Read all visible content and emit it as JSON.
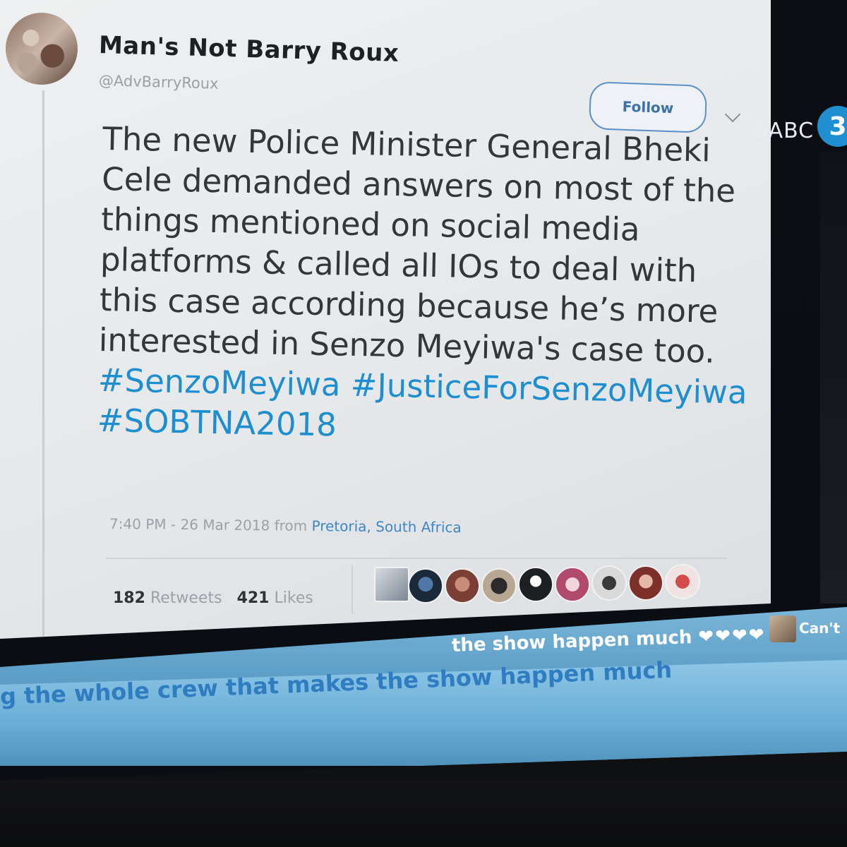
{
  "tweet": {
    "author_name": "Man's Not Barry Roux",
    "author_handle": "@AdvBarryRoux",
    "follow_label": "Follow",
    "text_lines": [
      "The new Police Minister General Bheki",
      "Cele demanded answers on most of the",
      "things mentioned on social media",
      "platforms & called all IOs to deal with",
      "this case according because he’s more",
      "interested in Senzo Meyiwa's case too."
    ],
    "hashtags_line_1": [
      "#SenzoMeyiwa",
      "#JusticeForSenzoMeyiwa"
    ],
    "hashtags_line_2": "#SOBTNA2018",
    "time": "7:40 PM - 26 Mar 2018",
    "from_label": "from",
    "location": "Pretoria, South Africa",
    "retweets_count": "182",
    "retweets_label": "Retweets",
    "likes_count": "421",
    "likes_label": "Likes"
  },
  "channel": {
    "logo_text": "SABC",
    "logo_number": "3"
  },
  "ticker": {
    "upper_text": "the show happen much",
    "upper_hearts": "❤❤❤❤",
    "next_text": "Can't",
    "lower_text": "g the whole crew that makes the show happen much"
  },
  "colors": {
    "hashtag": "#1d8fd0",
    "ticker_band": "#6aaed6",
    "card_background": "#e6e8ea"
  },
  "icons": [
    "caret-down-icon",
    "avatar",
    "liker-avatars"
  ]
}
